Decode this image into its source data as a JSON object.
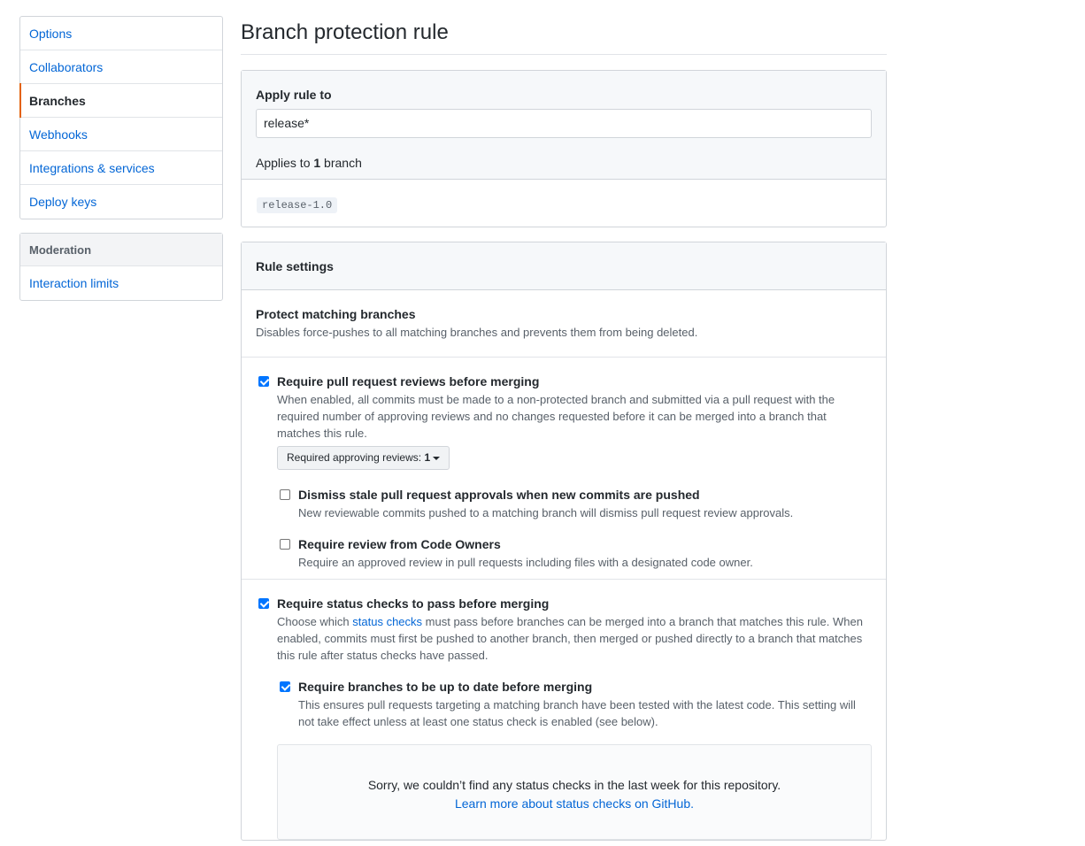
{
  "sidebar": {
    "menu1": [
      {
        "label": "Options",
        "selected": false
      },
      {
        "label": "Collaborators",
        "selected": false
      },
      {
        "label": "Branches",
        "selected": true
      },
      {
        "label": "Webhooks",
        "selected": false
      },
      {
        "label": "Integrations & services",
        "selected": false
      },
      {
        "label": "Deploy keys",
        "selected": false
      }
    ],
    "moderation": {
      "heading": "Moderation",
      "items": [
        {
          "label": "Interaction limits"
        }
      ]
    }
  },
  "page": {
    "title": "Branch protection rule"
  },
  "apply": {
    "label": "Apply rule to",
    "input_value": "release*",
    "applies_prefix": "Applies to ",
    "applies_count": "1",
    "applies_suffix": " branch",
    "matching_branch": "release-1.0"
  },
  "rules": {
    "heading": "Rule settings",
    "protect": {
      "title": "Protect matching branches",
      "desc": "Disables force-pushes to all matching branches and prevents them from being deleted."
    },
    "reviews": {
      "checked": true,
      "title": "Require pull request reviews before merging",
      "desc": "When enabled, all commits must be made to a non-protected branch and submitted via a pull request with the required number of approving reviews and no changes requested before it can be merged into a branch that matches this rule.",
      "select_label": "Required approving reviews:",
      "select_value": "1",
      "dismiss": {
        "checked": false,
        "title": "Dismiss stale pull request approvals when new commits are pushed",
        "desc": "New reviewable commits pushed to a matching branch will dismiss pull request review approvals."
      },
      "code_owners": {
        "checked": false,
        "title": "Require review from Code Owners",
        "desc": "Require an approved review in pull requests including files with a designated code owner."
      }
    },
    "status": {
      "checked": true,
      "title": "Require status checks to pass before merging",
      "desc_before": "Choose which ",
      "desc_link": "status checks",
      "desc_after": " must pass before branches can be merged into a branch that matches this rule. When enabled, commits must first be pushed to another branch, then merged or pushed directly to a branch that matches this rule after status checks have passed.",
      "up_to_date": {
        "checked": true,
        "title": "Require branches to be up to date before merging",
        "desc": "This ensures pull requests targeting a matching branch have been tested with the latest code. This setting will not take effect unless at least one status check is enabled (see below)."
      },
      "empty_message": "Sorry, we couldn’t find any status checks in the last week for this repository.",
      "empty_link": "Learn more about status checks on GitHub."
    }
  }
}
